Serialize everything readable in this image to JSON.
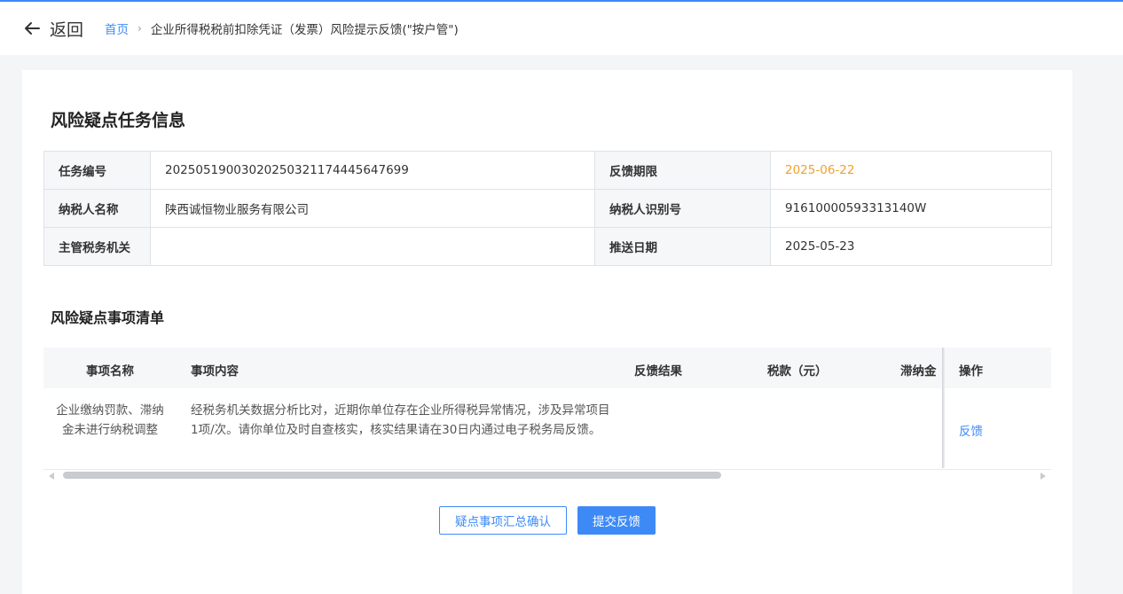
{
  "header": {
    "back_label": "返回",
    "breadcrumb_home": "首页",
    "breadcrumb_separator": "›",
    "breadcrumb_current": "企业所得税税前扣除凭证（发票）风险提示反馈(\"按户管\")"
  },
  "task_info": {
    "title": "风险疑点任务信息",
    "task_no_label": "任务编号",
    "task_no": "20250519003020250321174445647699",
    "deadline_label": "反馈期限",
    "deadline": "2025-06-22",
    "taxpayer_name_label": "纳税人名称",
    "taxpayer_name": "陕西诚恒物业服务有限公司",
    "taxpayer_id_label": "纳税人识别号",
    "taxpayer_id": "91610000593313140W",
    "tax_authority_label": "主管税务机关",
    "tax_authority": "",
    "push_date_label": "推送日期",
    "push_date": "2025-05-23"
  },
  "risk_list": {
    "title": "风险疑点事项清单",
    "columns": {
      "name": "事项名称",
      "content": "事项内容",
      "result": "反馈结果",
      "tax": "税款（元）",
      "late_fee": "滞纳金",
      "op": "操作"
    },
    "rows": [
      {
        "name": "企业缴纳罚款、滞纳金未进行纳税调整",
        "content": "经税务机关数据分析比对，近期你单位存在企业所得税异常情况，涉及异常项目1项/次。请你单位及时自查核实，核实结果请在30日内通过电子税务局反馈。",
        "result": "",
        "tax": "",
        "late_fee": "",
        "op": "反馈"
      }
    ]
  },
  "actions": {
    "confirm_label": "疑点事项汇总确认",
    "submit_label": "提交反馈"
  },
  "colors": {
    "accent": "#3d8af7",
    "deadline": "#f0a030"
  }
}
